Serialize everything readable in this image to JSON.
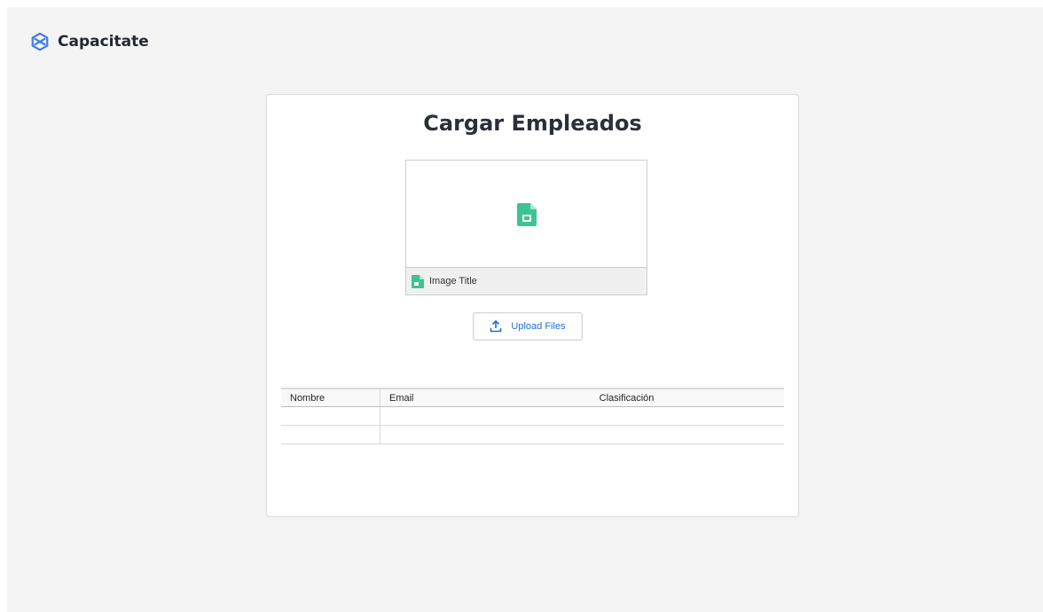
{
  "app": {
    "brand_name": "Capacitate",
    "brand_icon": "cube-icon",
    "brand_color": "#3d7be6"
  },
  "card": {
    "title": "Cargar Empleados"
  },
  "file_preview": {
    "icon": "image-file-icon",
    "file_title": "Image Title",
    "icon_color": "#3cc492"
  },
  "upload": {
    "label": "Upload Files",
    "icon": "upload-icon",
    "color": "#1e6fd8"
  },
  "table": {
    "columns": [
      "Nombre",
      "Email",
      "Clasificación"
    ],
    "rows": [
      [
        "",
        "",
        ""
      ],
      [
        "",
        "",
        ""
      ]
    ]
  }
}
